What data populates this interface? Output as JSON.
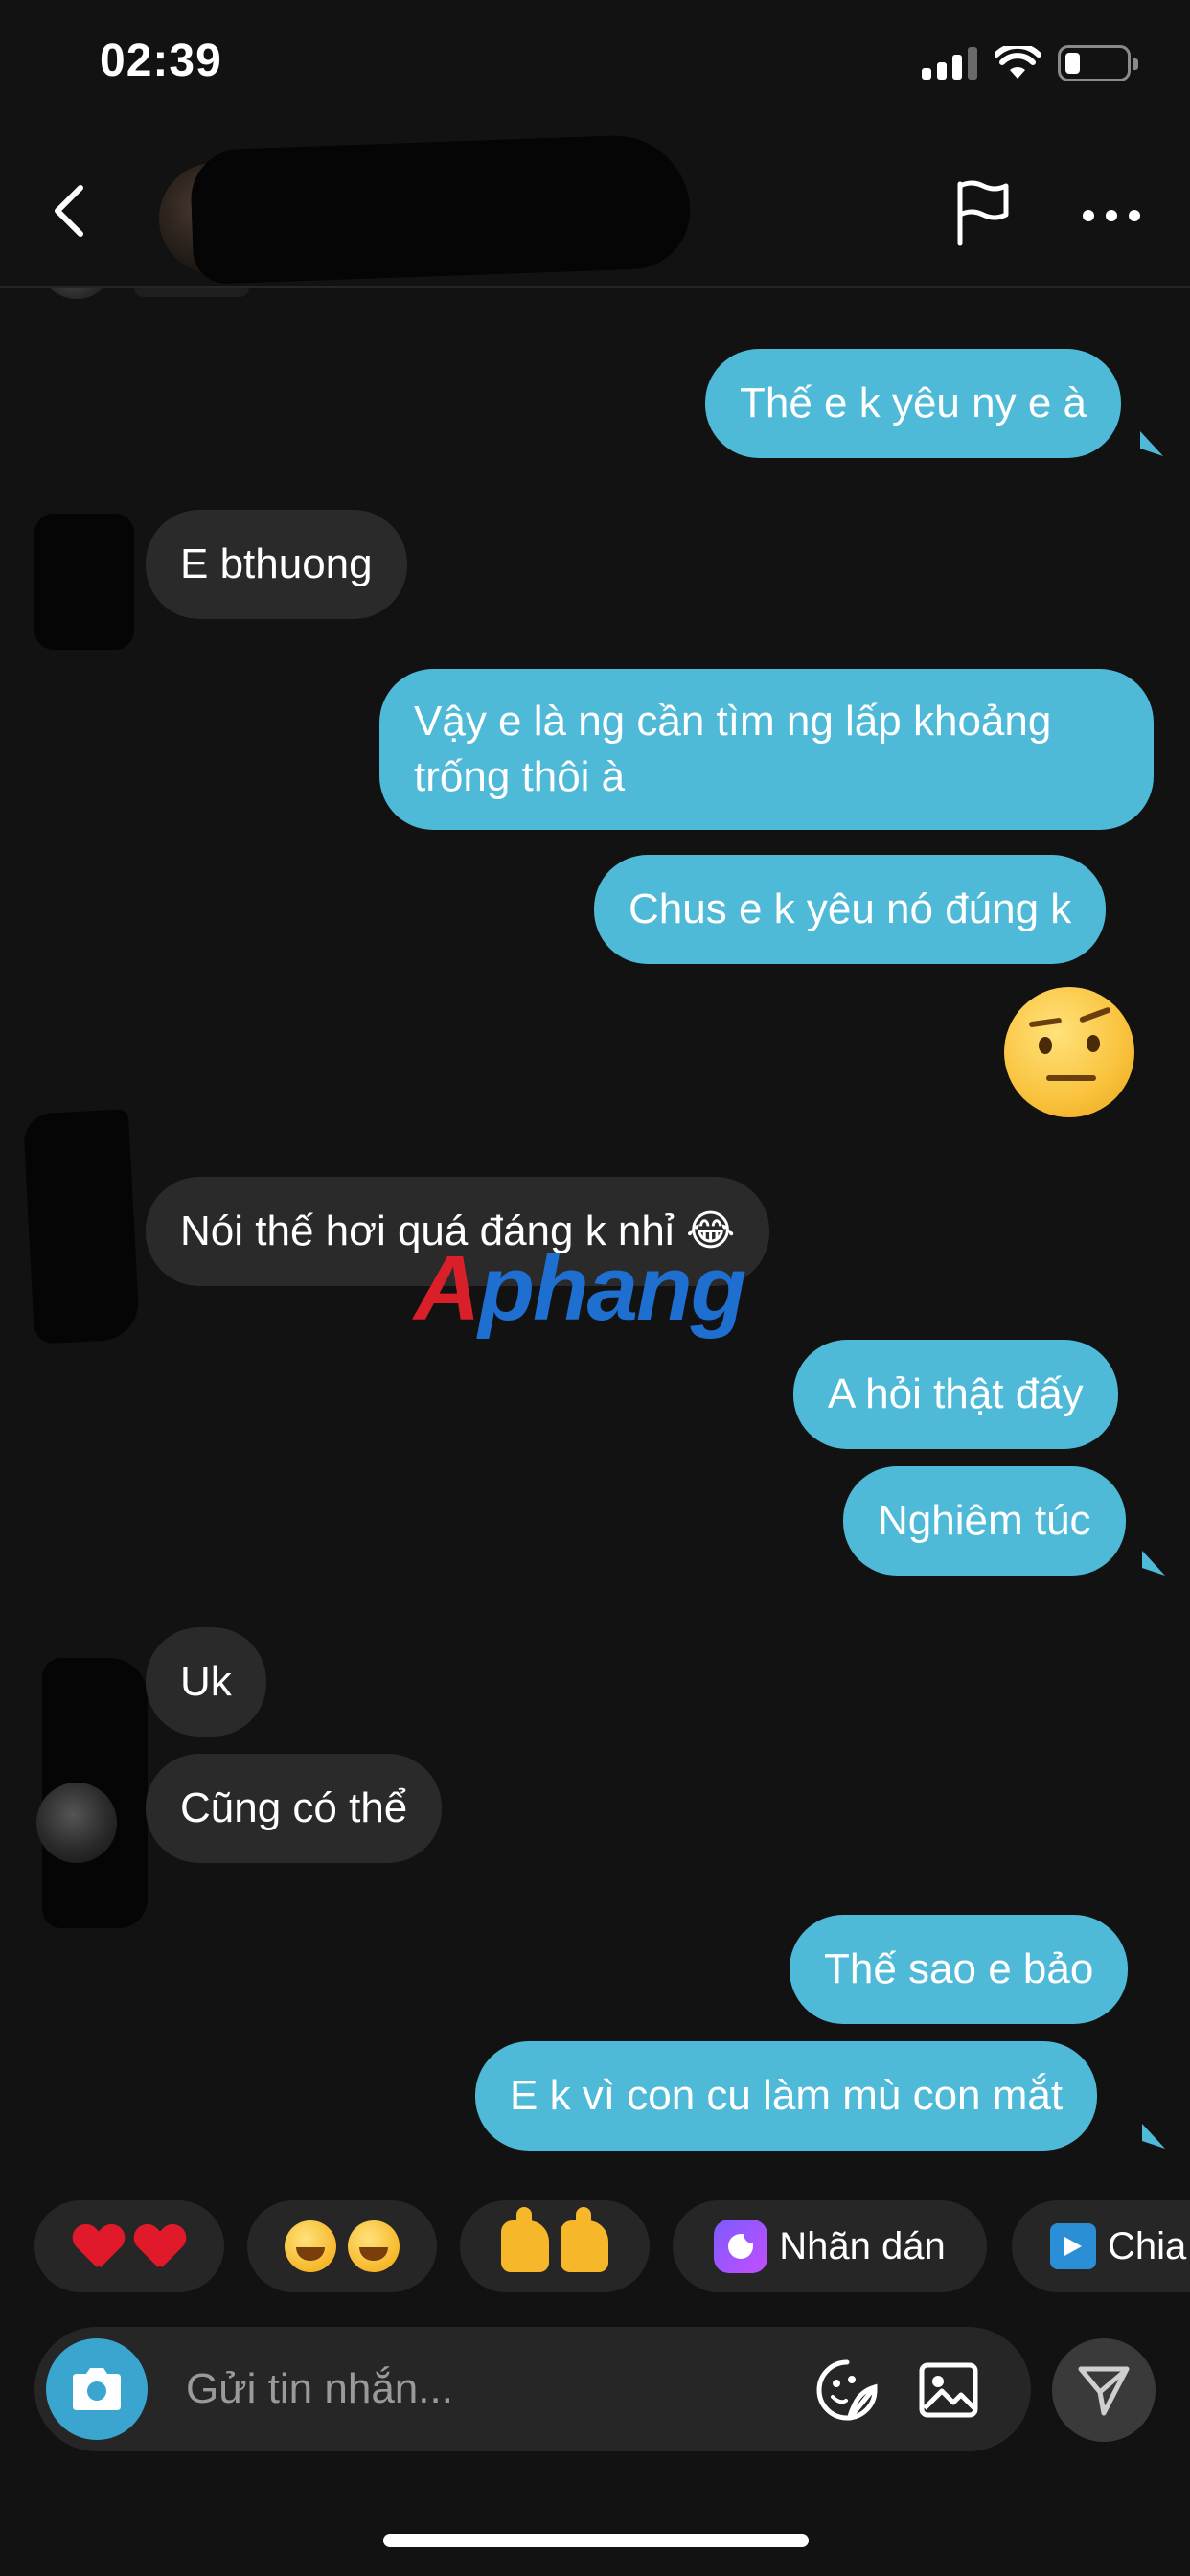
{
  "status_bar": {
    "time": "02:39"
  },
  "header": {
    "contact_name": ""
  },
  "messages": [
    {
      "direction": "out",
      "text": "Thế e k yêu ny e à"
    },
    {
      "direction": "in",
      "text": "E bthuong"
    },
    {
      "direction": "out",
      "text": "Vậy e là ng cần tìm ng lấp khoảng trống thôi à"
    },
    {
      "direction": "out",
      "text": "Chus e k yêu nó đúng k"
    },
    {
      "direction": "out",
      "type": "emoji",
      "emoji": "face-with-raised-eyebrow"
    },
    {
      "direction": "in",
      "text": "Nói thế hơi quá đáng k nhỉ 😂"
    },
    {
      "direction": "out",
      "text": "A hỏi thật đấy"
    },
    {
      "direction": "out",
      "text": "Nghiêm túc"
    },
    {
      "direction": "in",
      "text": "Uk"
    },
    {
      "direction": "in",
      "text": "Cũng có thể"
    },
    {
      "direction": "out",
      "text": "Thế sao e bảo"
    },
    {
      "direction": "out",
      "text": "E k vì con cu làm mù con mắt"
    }
  ],
  "watermark": {
    "part1": "A",
    "part2": "phang"
  },
  "quick_replies": [
    {
      "icon": "heart-icon",
      "count": 2
    },
    {
      "icon": "laugh-cry-icon",
      "count": 2
    },
    {
      "icon": "thumbs-up-icon",
      "count": 2
    },
    {
      "icon": "sticker-icon",
      "label": "Nhãn dán"
    },
    {
      "icon": "play-icon",
      "label": "Chia"
    }
  ],
  "composer": {
    "placeholder": "Gửi tin nhắn..."
  },
  "colors": {
    "background": "#121212",
    "outgoing_bubble": "#4fb9d8",
    "incoming_bubble": "#2a2a2a",
    "camera_button": "#3aa6cf"
  }
}
